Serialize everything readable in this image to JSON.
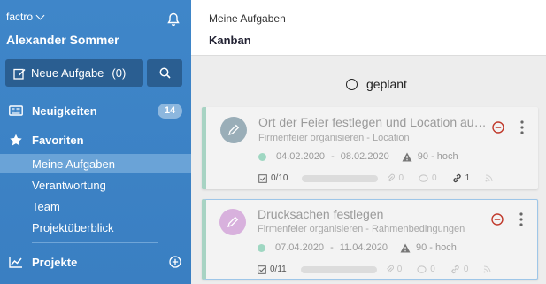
{
  "sidebar": {
    "workspace": "factro",
    "user_name": "Alexander Sommer",
    "new_task_label": "Neue Aufgabe",
    "new_task_count": "(0)",
    "nav": {
      "news": {
        "label": "Neuigkeiten",
        "badge": "14"
      },
      "favorites": {
        "label": "Favoriten"
      },
      "my_tasks": "Meine Aufgaben",
      "responsibility": "Verantwortung",
      "team": "Team",
      "project_overview": "Projektüberblick",
      "projects": {
        "label": "Projekte"
      }
    }
  },
  "main": {
    "breadcrumb": "Meine Aufgaben",
    "view_title": "Kanban",
    "column": {
      "label": "geplant"
    },
    "cards": [
      {
        "title": "Ort der Feier festlegen und Location aus…",
        "project": "Firmenfeier organisieren - Location",
        "start": "04.02.2020",
        "date_sep": "-",
        "end": "08.02.2020",
        "priority": "90 - hoch",
        "checklist": "0/10",
        "progress": 0,
        "attachments": "0",
        "comments": "0",
        "links": "1",
        "avatar_color": "#9aaeb8"
      },
      {
        "title": "Drucksachen festlegen",
        "project": "Firmenfeier organisieren - Rahmenbedingungen",
        "start": "07.04.2020",
        "date_sep": "-",
        "end": "11.04.2020",
        "priority": "90 - hoch",
        "checklist": "0/11",
        "progress": 0,
        "attachments": "0",
        "comments": "0",
        "links": "0",
        "avatar_color": "#d8b1dd"
      }
    ]
  },
  "colors": {
    "sidebar": "#3f86c9",
    "status_dot": "#9fd7c2",
    "card_accent": "#a7d3c3",
    "remove": "#c0392b"
  },
  "icons": [
    "chevron-down-icon",
    "bell-icon",
    "edit-icon",
    "search-icon",
    "newspaper-icon",
    "star-icon",
    "chart-icon",
    "plus-circle-icon",
    "circle-icon",
    "pencil-icon",
    "minus-circle-icon",
    "more-vertical-icon",
    "warning-icon",
    "checkbox-icon",
    "paperclip-icon",
    "comment-icon",
    "link-icon",
    "rss-icon"
  ]
}
